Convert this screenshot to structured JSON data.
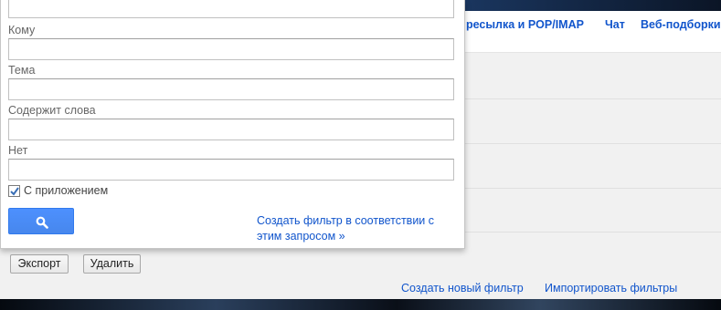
{
  "tabs": [
    {
      "label": "ресылка и POP/IMAP"
    },
    {
      "label": "Чат"
    },
    {
      "label": "Веб-подборки"
    }
  ],
  "search_form": {
    "from_value": "",
    "to_label": "Кому",
    "to_value": "",
    "subject_label": "Тема",
    "subject_value": "",
    "has_words_label": "Содержит слова",
    "has_words_value": "",
    "doesnt_have_label": "Нет",
    "doesnt_have_value": "",
    "has_attachment_label": "С приложением",
    "has_attachment_checked": true,
    "search_button_icon": "search-icon",
    "create_filter_link": "Создать фильтр в соответствии с этим запросом »"
  },
  "filter_actions": {
    "export_label": "Экспорт",
    "delete_label": "Удалить"
  },
  "bottom_links": {
    "create_new_filter": "Создать новый фильтр",
    "import_filters": "Импортировать фильтры"
  },
  "colors": {
    "link": "#1155cc",
    "search_button": "#4d90fe"
  }
}
